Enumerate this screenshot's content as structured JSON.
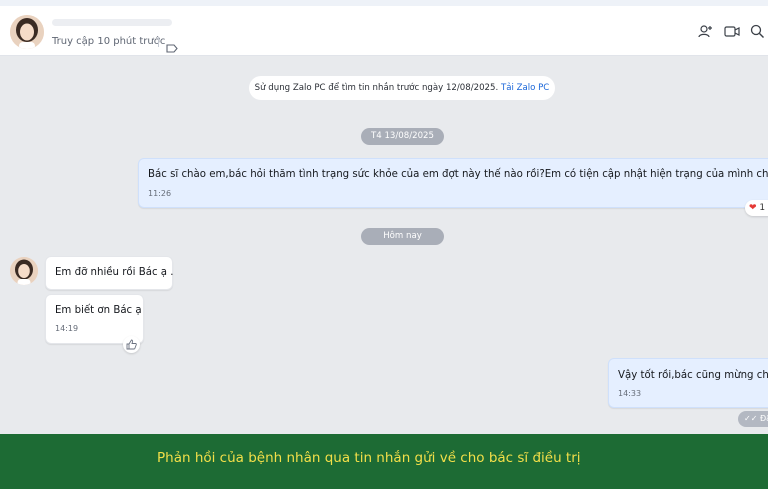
{
  "header": {
    "status": "Truy cập 10 phút trước",
    "icons": [
      "add-member-icon",
      "video-call-icon",
      "search-icon",
      "tag-icon"
    ]
  },
  "chat": {
    "notice_text": "Sử dụng Zalo PC để tìm tin nhắn trước ngày 12/08/2025.",
    "notice_link": "Tải Zalo PC",
    "date_separators": [
      "T4 13/08/2025",
      "Hôm nay"
    ],
    "messages": [
      {
        "side": "out",
        "text": "Bác sĩ chào em,bác hỏi thăm tình trạng sức khỏe của em đợt này thế nào rồi?Em có tiện cập nhật hiện trạng của mình cho bác sĩ",
        "time": "11:26",
        "reaction": "1"
      },
      {
        "side": "in",
        "text": "Em đỡ nhiều rồi Bác ạ ."
      },
      {
        "side": "in",
        "text": "Em biết ơn Bác ạ",
        "time": "14:19"
      },
      {
        "side": "out",
        "text": "Vậy tốt rồi,bác cũng mừng cho",
        "time": "14:33",
        "status": "Đã"
      }
    ]
  },
  "caption": "Phản hồi của bệnh nhân qua tin nhắn gửi về cho bác sĩ điều trị",
  "colors": {
    "caption_bg": "#1d6b34",
    "caption_text": "#f3df49",
    "out_bubble": "#e5efff",
    "link": "#1a66d9"
  }
}
